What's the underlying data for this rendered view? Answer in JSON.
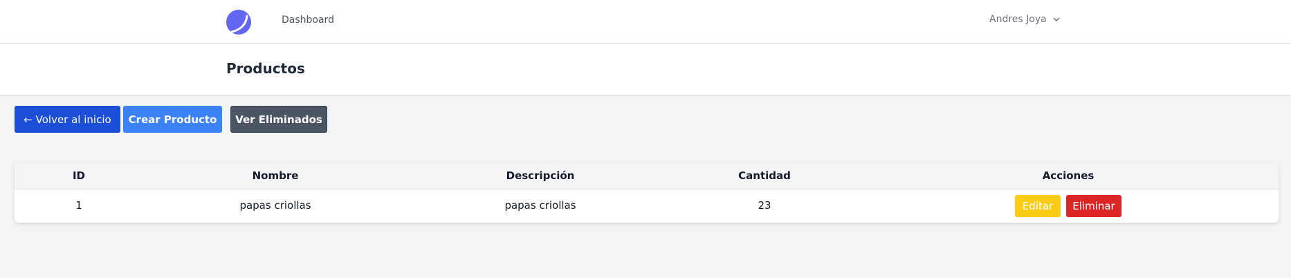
{
  "nav": {
    "logo_icon": "app-logo-icon",
    "dashboard_label": "Dashboard",
    "user_name": "Andres Joya",
    "user_menu_icon": "chevron-down-icon"
  },
  "header": {
    "title": "Productos"
  },
  "toolbar": {
    "back_label": "← Volver al inicio",
    "create_label": "Crear Producto",
    "deleted_label": "Ver Eliminados"
  },
  "table": {
    "headers": {
      "id": "ID",
      "name": "Nombre",
      "description": "Descripción",
      "quantity": "Cantidad",
      "actions": "Acciones"
    },
    "rows": [
      {
        "id": "1",
        "name": "papas criollas",
        "description": "papas criollas",
        "quantity": "23",
        "edit_label": "Editar",
        "delete_label": "Eliminar"
      }
    ]
  },
  "colors": {
    "logo": "#6366f1",
    "back_button": "#1d4ed8",
    "create_button": "#3b82f6",
    "deleted_button": "#4b5563",
    "edit_button": "#facc15",
    "delete_button": "#dc2626"
  }
}
